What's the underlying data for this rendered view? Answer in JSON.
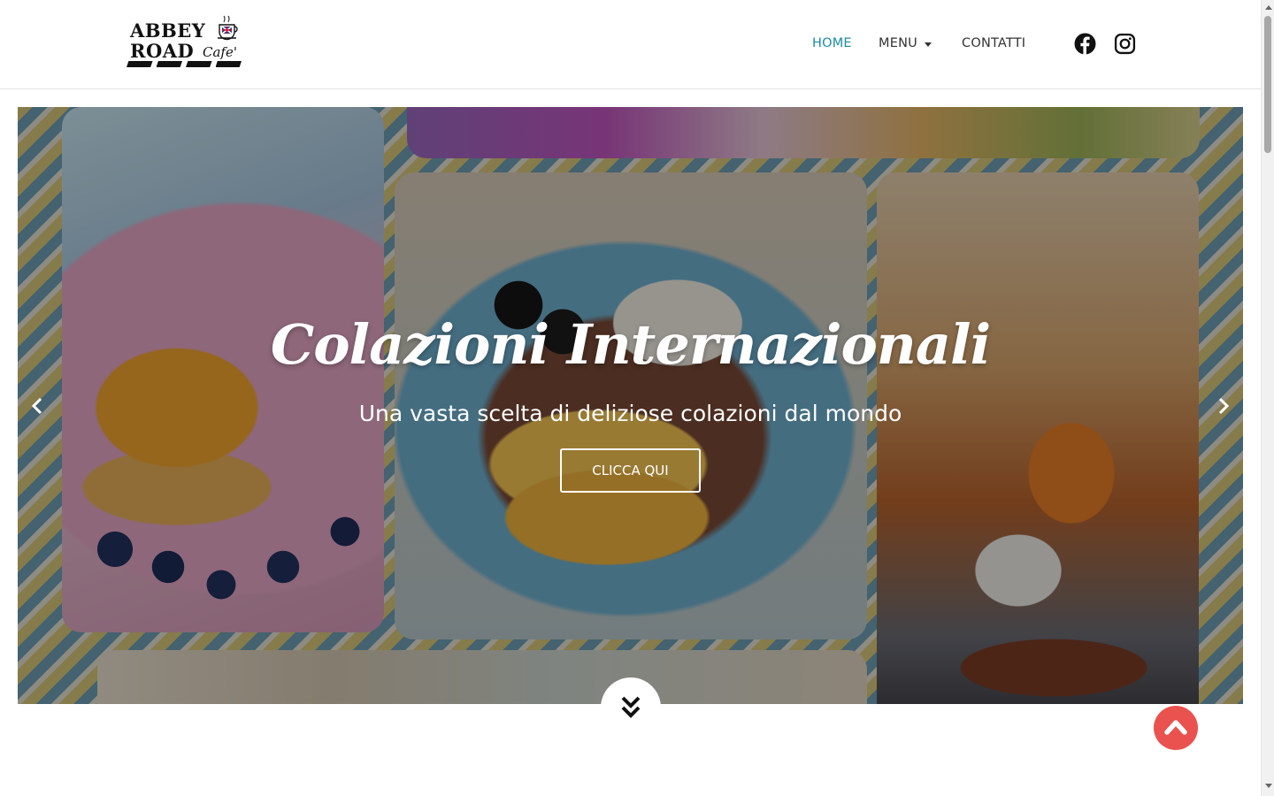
{
  "brand": {
    "line1": "ABBEY",
    "line2": "ROAD",
    "script": "Cafe'"
  },
  "nav": {
    "home": "HOME",
    "menu": "MENU",
    "contatti": "CONTATTI",
    "active": "HOME",
    "active_color": "#1b8ba3"
  },
  "social": [
    "facebook-icon",
    "instagram-icon"
  ],
  "hero": {
    "title": "Colazioni Internazionali",
    "subtitle": "Una vasta scelta di deliziose colazioni dal mondo",
    "cta": "CLICCA QUI"
  },
  "controls": {
    "prev": "chevron-left-icon",
    "next": "chevron-right-icon",
    "scroll_down": "double-chevron-down-icon",
    "back_to_top": "chevron-up-icon",
    "back_to_top_color": "#e9524f"
  }
}
